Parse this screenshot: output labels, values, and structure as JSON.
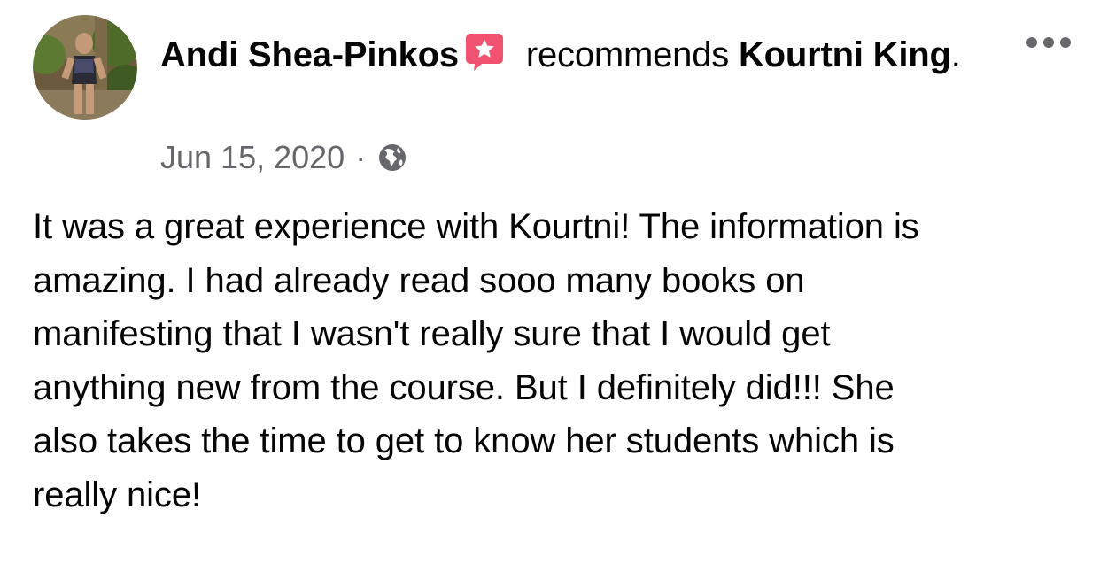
{
  "post": {
    "author": "Andi Shea-Pinkos",
    "action": "recommends",
    "target": "Kourtni King",
    "target_suffix": ".",
    "date": "Jun 15, 2020",
    "separator": "·",
    "audience_icon": "globe-icon",
    "badge_icon": "recommendation-star-icon",
    "more_icon": "more-options-icon",
    "body": "It was a great experience with Kourtni! The information is\namazing.  I had already read sooo many books on\nmanifesting that I wasn't really sure that I would get\nanything new from the course.  But I definitely did!!!  She\nalso takes the time to get to know her students which is\nreally nice!"
  },
  "colors": {
    "text_primary": "#050505",
    "text_secondary": "#65676b",
    "badge_pink": "#f0526f",
    "background": "#ffffff"
  }
}
